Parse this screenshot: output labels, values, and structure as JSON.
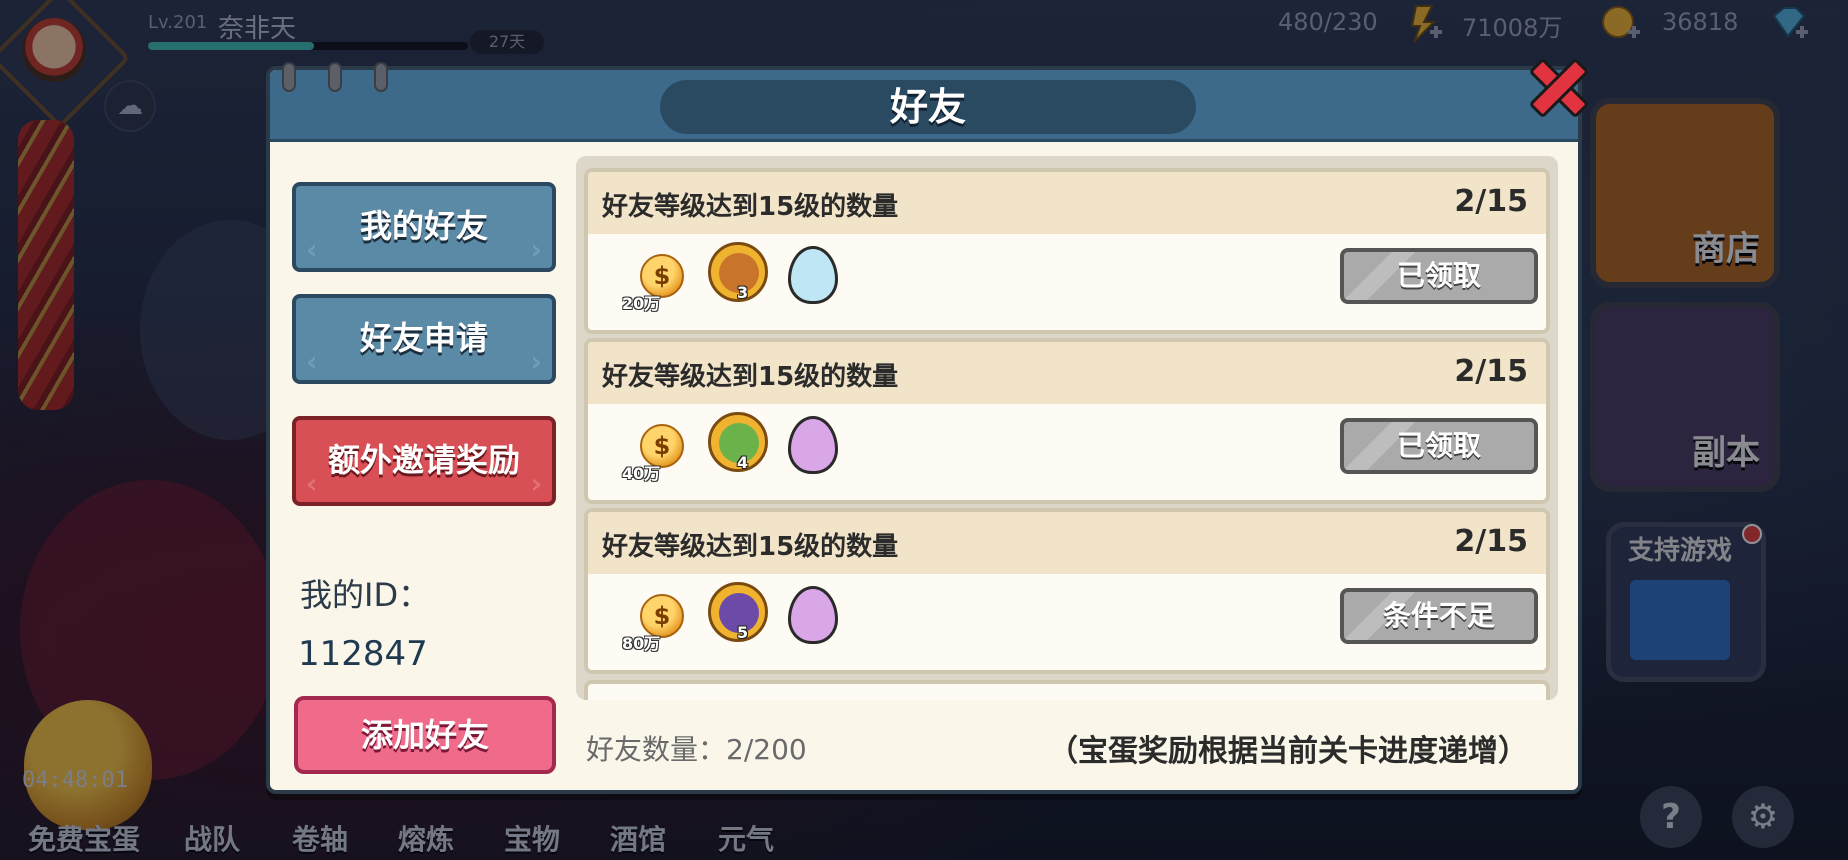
{
  "player": {
    "level": "Lv.201",
    "name": "奈非天",
    "xp_fraction": 0.52,
    "days": "27天"
  },
  "resources": {
    "stamina": "480/230",
    "gold": "71008万",
    "gems": "36818"
  },
  "timer": "04:48:01",
  "bottom_nav": [
    "免费宝蛋",
    "战队",
    "卷轴",
    "熔炼",
    "宝物",
    "酒馆",
    "元气"
  ],
  "side_buttons": {
    "shop": "商店",
    "dungeon": "副本",
    "support": "支持游戏"
  },
  "dialog": {
    "title": "好友",
    "tabs": {
      "my_friends": "我的好友",
      "requests": "好友申请",
      "extra_reward": "额外邀请奖励"
    },
    "my_id_label": "我的ID：",
    "my_id_value": "112847",
    "add_friend": "添加好友",
    "rewards": [
      {
        "title": "好友等级达到15级的数量",
        "progress": "2/15",
        "coin_amount": "20万",
        "hero_level": "3",
        "hero_color": "#c8742a",
        "egg_color": "#bfe6f5",
        "button": "已领取"
      },
      {
        "title": "好友等级达到15级的数量",
        "progress": "2/15",
        "coin_amount": "40万",
        "hero_level": "4",
        "hero_color": "#6bb24a",
        "egg_color": "#d9a6e8",
        "button": "已领取"
      },
      {
        "title": "好友等级达到15级的数量",
        "progress": "2/15",
        "coin_amount": "80万",
        "hero_level": "5",
        "hero_color": "#6b4aa8",
        "egg_color": "#d9a6e8",
        "button": "条件不足"
      }
    ],
    "friend_count": "好友数量：2/200",
    "egg_note": "（宝蛋奖励根据当前关卡进度递增）"
  },
  "icons": {
    "coin": "$",
    "cloud": "☁",
    "close": "close-icon",
    "help": "?",
    "settings": "⚙"
  },
  "colors": {
    "header_blue": "#3d6a8a",
    "tab_blue": "#5b8aa6",
    "tab_red": "#d84f55",
    "add_pink": "#f06a8a",
    "claimed_gray": "#aaaaaa"
  }
}
